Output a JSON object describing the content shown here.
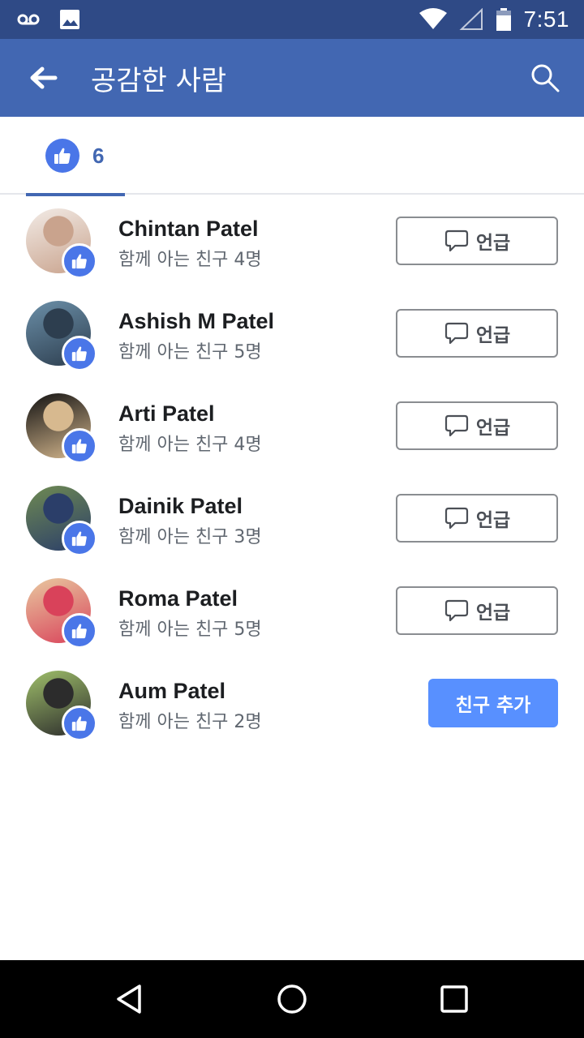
{
  "status_bar": {
    "time": "7:51",
    "icons": [
      "voicemail-icon",
      "image-icon",
      "wifi-icon",
      "signal-icon",
      "battery-icon"
    ]
  },
  "app_bar": {
    "title": "공감한 사람",
    "back_icon": "arrow-left-icon",
    "search_icon": "search-icon"
  },
  "tabs": [
    {
      "icon": "like-icon",
      "count": "6",
      "selected": true
    }
  ],
  "people": [
    {
      "name": "Chintan Patel",
      "mutual": "함께 아는 친구 4명",
      "action": "언급",
      "action_type": "mention",
      "avatar_colors": [
        "#f2ebe6",
        "#c9a38d"
      ]
    },
    {
      "name": "Ashish M Patel",
      "mutual": "함께 아는 친구 5명",
      "action": "언급",
      "action_type": "mention",
      "avatar_colors": [
        "#6b8fa8",
        "#2d3e4f"
      ]
    },
    {
      "name": "Arti Patel",
      "mutual": "함께 아는 친구 4명",
      "action": "언급",
      "action_type": "mention",
      "avatar_colors": [
        "#111111",
        "#d7b98f"
      ]
    },
    {
      "name": "Dainik Patel",
      "mutual": "함께 아는 친구 3명",
      "action": "언급",
      "action_type": "mention",
      "avatar_colors": [
        "#6f8a52",
        "#2b3e69"
      ]
    },
    {
      "name": "Roma Patel",
      "mutual": "함께 아는 친구 5명",
      "action": "언급",
      "action_type": "mention",
      "avatar_colors": [
        "#e8c9a0",
        "#d9425a"
      ]
    },
    {
      "name": "Aum Patel",
      "mutual": "함께 아는 친구 2명",
      "action": "친구 추가",
      "action_type": "add_friend",
      "avatar_colors": [
        "#9fbf6a",
        "#2c2c2c"
      ]
    }
  ],
  "nav_bar": {
    "icons": [
      "back-triangle-icon",
      "home-circle-icon",
      "recents-square-icon"
    ]
  },
  "colors": {
    "status_bar": "#2f4a86",
    "app_bar": "#4267b2",
    "like_blue": "#4a76e8",
    "add_button": "#5890ff"
  }
}
